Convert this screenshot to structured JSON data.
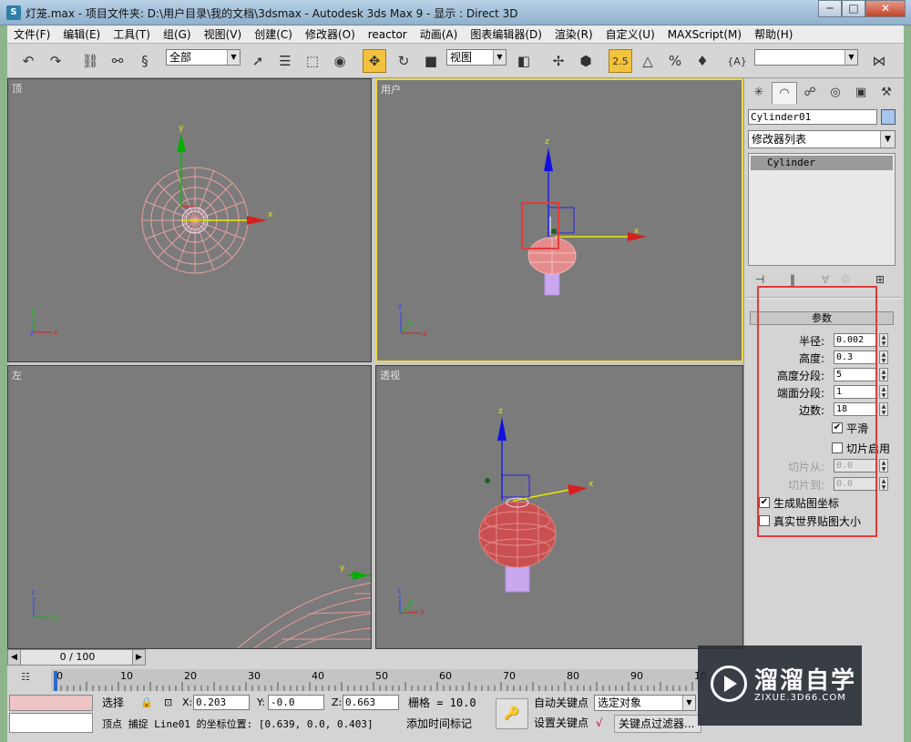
{
  "window": {
    "title": "灯笼.max    - 项目文件夹: D:\\用户目录\\我的文档\\3dsmax    - Autodesk 3ds Max 9    - 显示 : Direct 3D",
    "minimize": "─",
    "maximize": "□",
    "close": "✕"
  },
  "menu": [
    "文件(F)",
    "编辑(E)",
    "工具(T)",
    "组(G)",
    "视图(V)",
    "创建(C)",
    "修改器(O)",
    "reactor",
    "动画(A)",
    "图表编辑器(D)",
    "渲染(R)",
    "自定义(U)",
    "MAXScript(M)",
    "帮助(H)"
  ],
  "toolbar": {
    "selection_filter": "全部",
    "ref_coord": "视图",
    "snap_value": "2.5",
    "named_selection": ""
  },
  "viewports": {
    "top": "顶",
    "user": "用户",
    "left": "左",
    "perspective": "透视"
  },
  "axis": {
    "x": "x",
    "y": "y",
    "z": "z"
  },
  "command_panel": {
    "object_name": "Cylinder01",
    "modifier_list": "修改器列表",
    "stack_item": "Cylinder",
    "rollout_title": "参数",
    "params": {
      "radius_label": "半径:",
      "radius": "0.002",
      "height_label": "高度:",
      "height": "0.3",
      "height_segs_label": "高度分段:",
      "height_segs": "5",
      "cap_segs_label": "端面分段:",
      "cap_segs": "1",
      "sides_label": "边数:",
      "sides": "18",
      "smooth_label": "平滑",
      "slice_on_label": "切片启用",
      "slice_from_label": "切片从:",
      "slice_from": "0.0",
      "slice_to_label": "切片到:",
      "slice_to": "0.0",
      "gen_mapping_label": "生成贴图坐标",
      "real_world_label": "真实世界贴图大小"
    },
    "checks": {
      "smooth": "✔",
      "gen_mapping": "✔"
    }
  },
  "timeline": {
    "frame": "0 / 100",
    "ticks": [
      "0",
      "10",
      "20",
      "30",
      "40",
      "50",
      "60",
      "70",
      "80",
      "90",
      "100"
    ]
  },
  "status": {
    "selection": "选择",
    "x_label": "X:",
    "x": "0.203",
    "y_label": "Y:",
    "y": "-0.0",
    "z_label": "Z:",
    "z": "0.663",
    "grid": "栅格 = 10.0",
    "prompt": "顶点 捕捉 Line01 的坐标位置:   [0.639, 0.0, 0.403]",
    "add_time_tag": "添加时间标记",
    "auto_key": "自动关键点",
    "set_key": "设置关键点",
    "selected_object": "选定对象",
    "key_filter": "关键点过滤器..."
  },
  "watermark": {
    "name": "溜溜自学",
    "url": "ZIXUE.3D66.COM"
  }
}
